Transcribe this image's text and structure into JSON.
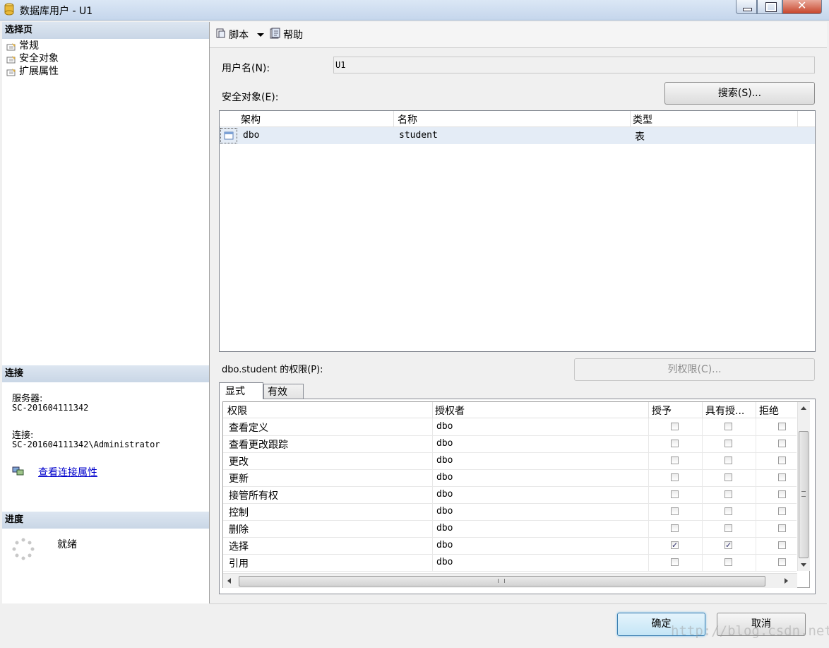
{
  "window": {
    "title": "数据库用户 - U1"
  },
  "left": {
    "select_page_header": "选择页",
    "nav_items": [
      "常规",
      "安全对象",
      "扩展属性"
    ],
    "connection_header": "连接",
    "server_label": "服务器:",
    "server_value": "SC-201604111342",
    "connection_label": "连接:",
    "connection_value": "SC-201604111342\\Administrator",
    "view_conn_link": "查看连接属性",
    "progress_header": "进度",
    "progress_status": "就绪"
  },
  "toolbar": {
    "script_label": "脚本",
    "help_label": "帮助"
  },
  "form": {
    "username_label": "用户名(N):",
    "username_value": "U1",
    "securables_label": "安全对象(E):",
    "search_button": "搜索(S)..."
  },
  "securables": {
    "columns": [
      "架构",
      "名称",
      "类型"
    ],
    "rows": [
      {
        "schema": "dbo",
        "name": "student",
        "type": "表"
      }
    ]
  },
  "permissions": {
    "label": "dbo.student 的权限(P):",
    "column_perm_button": "列权限(C)...",
    "tabs": [
      "显式",
      "有效"
    ],
    "columns": [
      "权限",
      "授权者",
      "授予",
      "具有授...",
      "拒绝"
    ],
    "rows": [
      {
        "perm": "查看定义",
        "grantor": "dbo",
        "grant": false,
        "with_grant": false,
        "deny": false
      },
      {
        "perm": "查看更改跟踪",
        "grantor": "dbo",
        "grant": false,
        "with_grant": false,
        "deny": false
      },
      {
        "perm": "更改",
        "grantor": "dbo",
        "grant": false,
        "with_grant": false,
        "deny": false
      },
      {
        "perm": "更新",
        "grantor": "dbo",
        "grant": false,
        "with_grant": false,
        "deny": false
      },
      {
        "perm": "接管所有权",
        "grantor": "dbo",
        "grant": false,
        "with_grant": false,
        "deny": false
      },
      {
        "perm": "控制",
        "grantor": "dbo",
        "grant": false,
        "with_grant": false,
        "deny": false
      },
      {
        "perm": "删除",
        "grantor": "dbo",
        "grant": false,
        "with_grant": false,
        "deny": false
      },
      {
        "perm": "选择",
        "grantor": "dbo",
        "grant": true,
        "with_grant": true,
        "deny": false
      },
      {
        "perm": "引用",
        "grantor": "dbo",
        "grant": false,
        "with_grant": false,
        "deny": false
      }
    ]
  },
  "footer": {
    "ok_button": "确定",
    "cancel_button": "取消"
  },
  "watermark": "http://blog.csdn.net/j"
}
